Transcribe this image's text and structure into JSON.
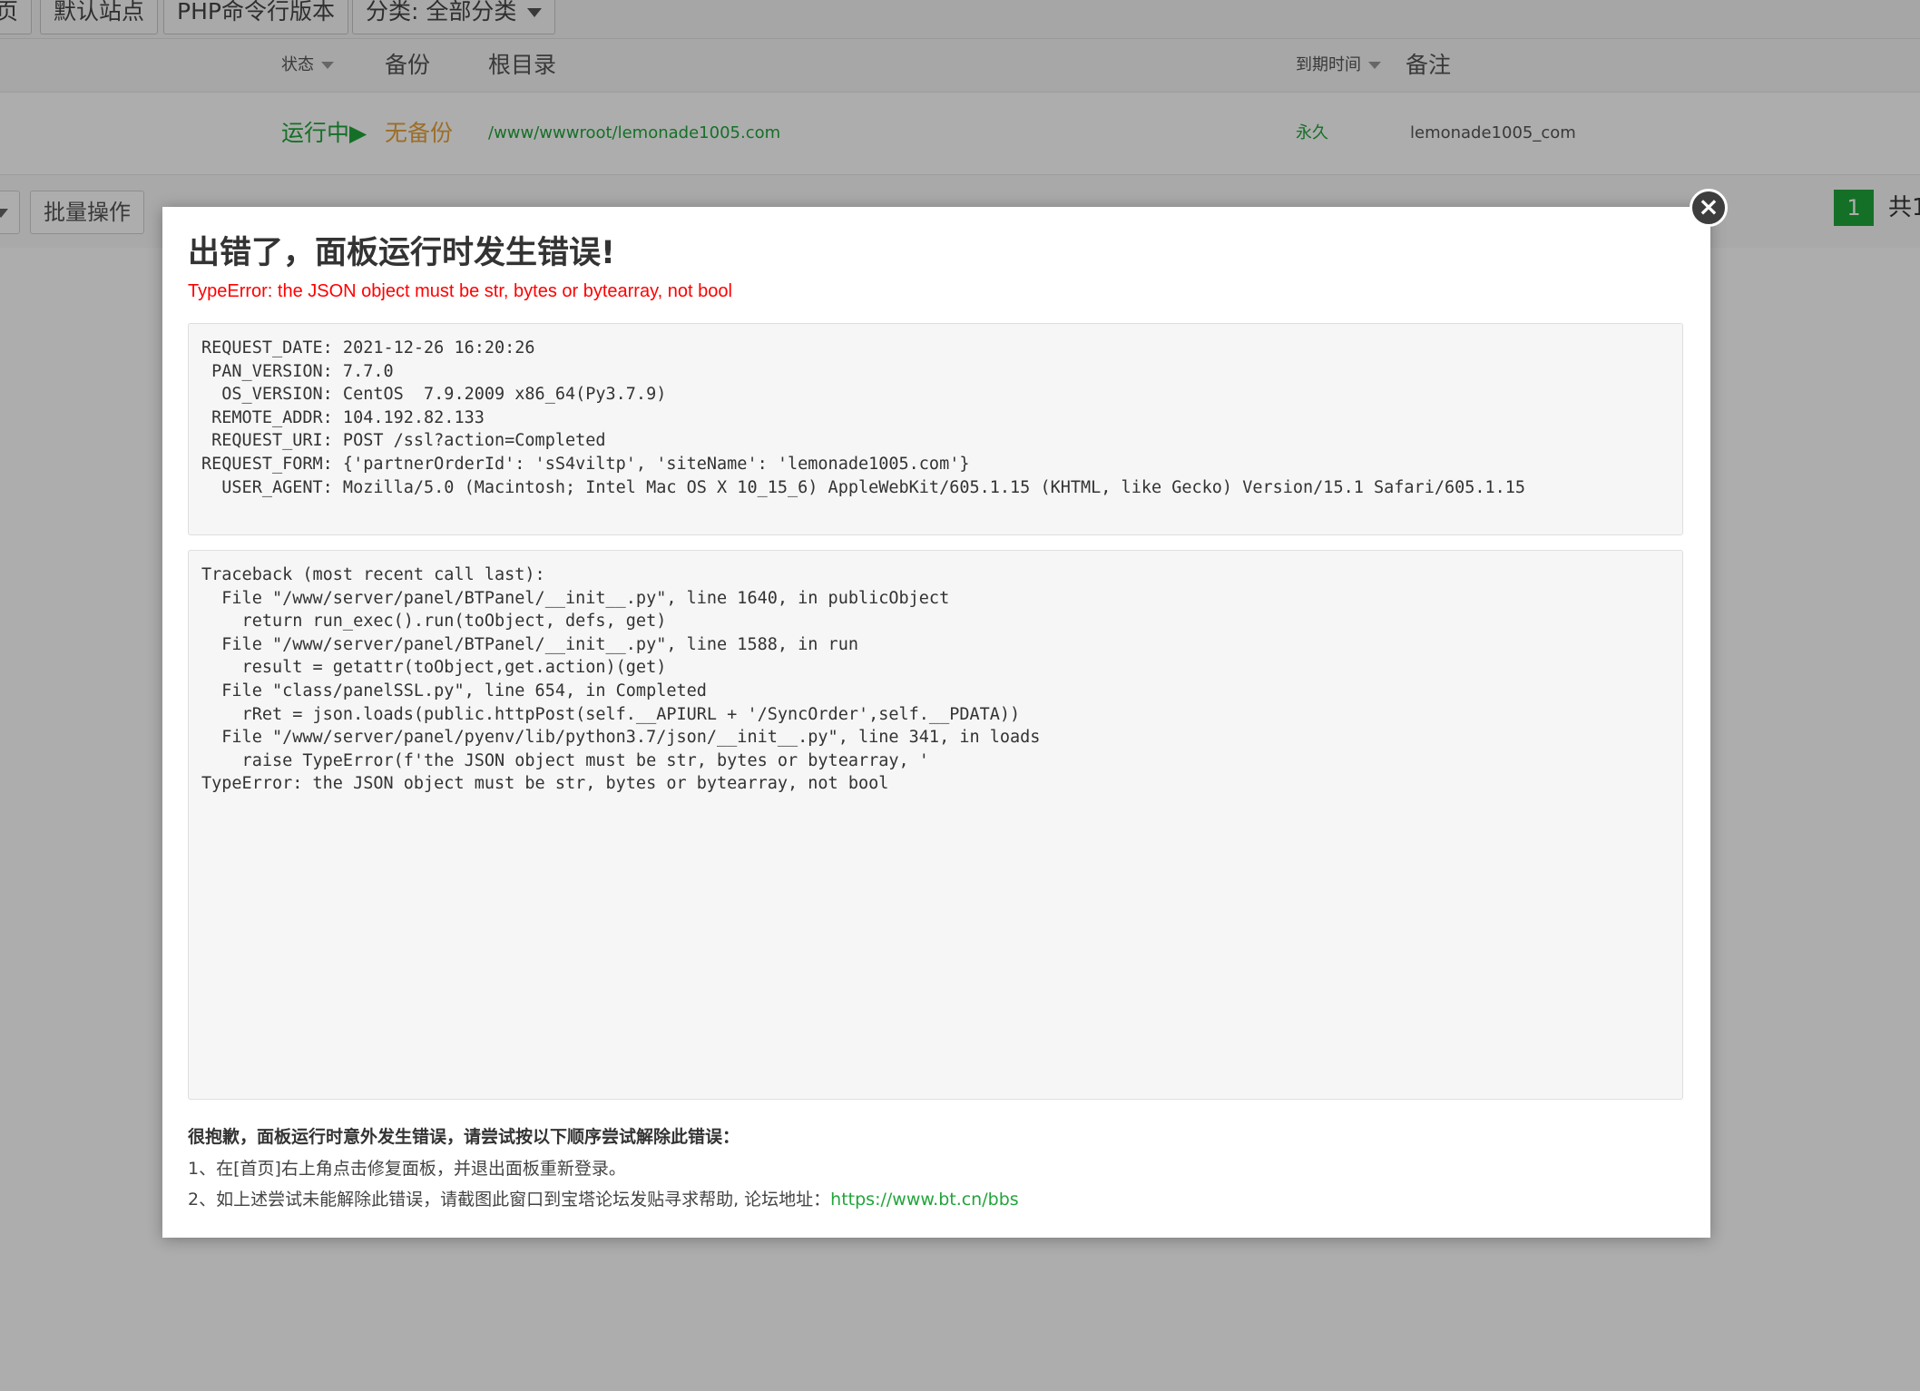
{
  "toolbar": {
    "btn_home_fragment": "页",
    "btn_default_site": "默认站点",
    "btn_php_cli": "PHP命令行版本",
    "category_select": "分类: 全部分类"
  },
  "table": {
    "headers": {
      "status": "状态",
      "backup": "备份",
      "root": "根目录",
      "expire": "到期时间",
      "remark": "备注"
    },
    "row": {
      "status": "运行中▶",
      "backup": "无备份",
      "root": "/www/wwwroot/lemonade1005.com",
      "expire": "永久",
      "remark": "lemonade1005_com"
    }
  },
  "footer": {
    "batch_button": "批量操作",
    "page_current": "1",
    "page_total_fragment": "共1"
  },
  "modal": {
    "close_glyph": "×",
    "title": "出错了，面板运行时发生错误!",
    "error": "TypeError: the JSON object must be str, bytes or bytearray, not bool",
    "request_info": "REQUEST_DATE: 2021-12-26 16:20:26\n PAN_VERSION: 7.7.0\n  OS_VERSION: CentOS  7.9.2009 x86_64(Py3.7.9)\n REMOTE_ADDR: 104.192.82.133\n REQUEST_URI: POST /ssl?action=Completed\nREQUEST_FORM: {'partnerOrderId': 'sS4viltp', 'siteName': 'lemonade1005.com'}\n  USER_AGENT: Mozilla/5.0 (Macintosh; Intel Mac OS X 10_15_6) AppleWebKit/605.1.15 (KHTML, like Gecko) Version/15.1 Safari/605.1.15",
    "traceback": "Traceback (most recent call last):\n  File \"/www/server/panel/BTPanel/__init__.py\", line 1640, in publicObject\n    return run_exec().run(toObject, defs, get)\n  File \"/www/server/panel/BTPanel/__init__.py\", line 1588, in run\n    result = getattr(toObject,get.action)(get)\n  File \"class/panelSSL.py\", line 654, in Completed\n    rRet = json.loads(public.httpPost(self.__APIURL + '/SyncOrder',self.__PDATA))\n  File \"/www/server/panel/pyenv/lib/python3.7/json/__init__.py\", line 341, in loads\n    raise TypeError(f'the JSON object must be str, bytes or bytearray, '\nTypeError: the JSON object must be str, bytes or bytearray, not bool",
    "help_title": "很抱歉，面板运行时意外发生错误，请尝试按以下顺序尝试解除此错误：",
    "help_step1": "1、在[首页]右上角点击修复面板，并退出面板重新登录。",
    "help_step2": "2、如上述尝试未能解除此错误，请截图此窗口到宝塔论坛发贴寻求帮助, 论坛地址：",
    "forum_link": "https://www.bt.cn/bbs"
  },
  "colors": {
    "accent_green": "#20a53a",
    "error_red": "#ff0000",
    "no_backup_orange": "#e6a23c"
  }
}
